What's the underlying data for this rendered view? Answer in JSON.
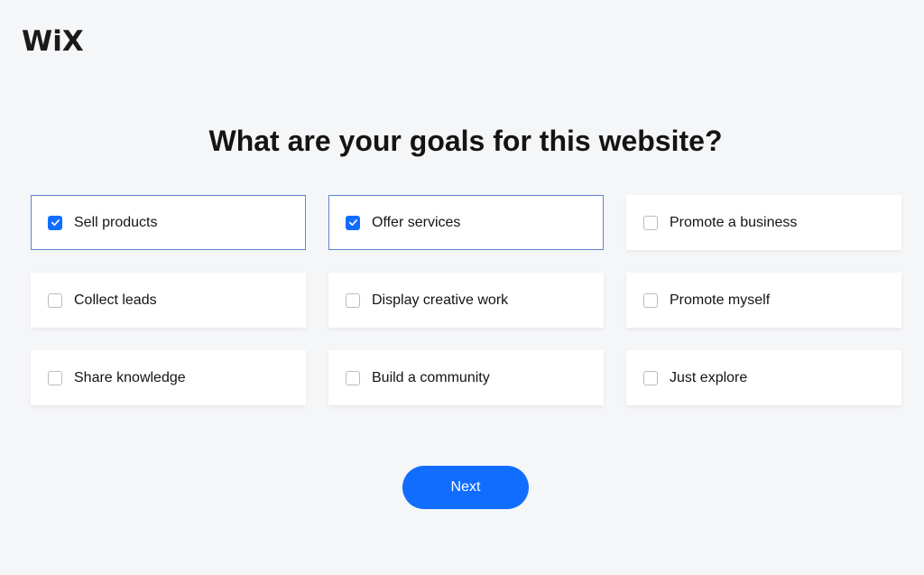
{
  "brand": {
    "logo_text": "WiX"
  },
  "page": {
    "title": "What are your goals for this website?"
  },
  "goals": [
    {
      "label": "Sell products",
      "checked": true
    },
    {
      "label": "Offer services",
      "checked": true
    },
    {
      "label": "Promote a business",
      "checked": false
    },
    {
      "label": "Collect leads",
      "checked": false
    },
    {
      "label": "Display creative work",
      "checked": false
    },
    {
      "label": "Promote myself",
      "checked": false
    },
    {
      "label": "Share knowledge",
      "checked": false
    },
    {
      "label": "Build a community",
      "checked": false
    },
    {
      "label": "Just explore",
      "checked": false
    }
  ],
  "actions": {
    "next_label": "Next"
  },
  "colors": {
    "accent": "#116dff",
    "selected_border": "#5b84d0",
    "background": "#f5f6f8"
  }
}
